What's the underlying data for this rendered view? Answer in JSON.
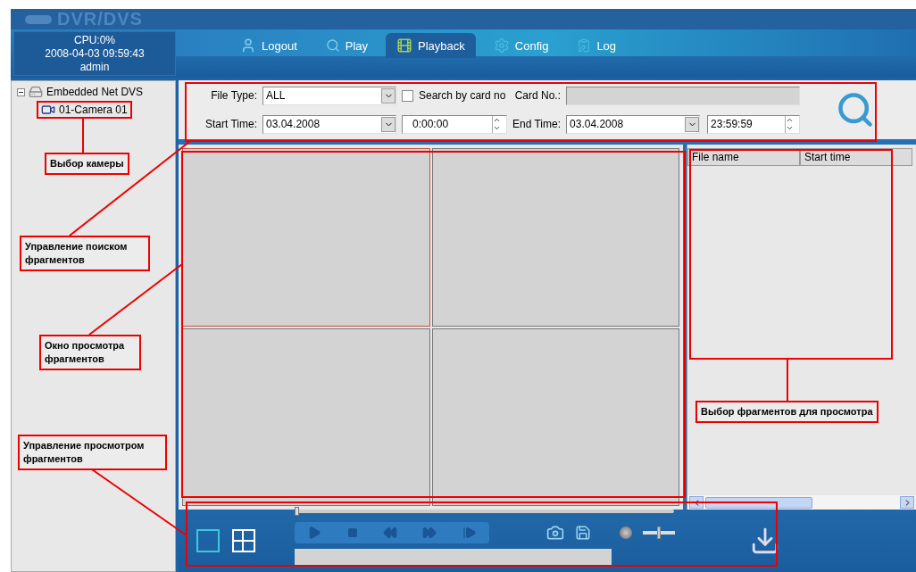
{
  "app": {
    "title": "DVR/DVS"
  },
  "status": {
    "cpu": "CPU:0%",
    "datetime": "2008-04-03 09:59:43",
    "user": "admin"
  },
  "tabs": [
    {
      "label": "Logout",
      "selected": false,
      "kind": "logout"
    },
    {
      "label": "Play",
      "selected": false,
      "kind": "play"
    },
    {
      "label": "Playback",
      "selected": true,
      "kind": "playback"
    },
    {
      "label": "Config",
      "selected": false,
      "kind": "config"
    },
    {
      "label": "Log",
      "selected": false,
      "kind": "log"
    }
  ],
  "tree": [
    {
      "label": "Embedded Net DVS",
      "expanded": true,
      "children": [
        {
          "label": "01-Camera 01"
        }
      ]
    }
  ],
  "search": {
    "file_type_label": "File Type:",
    "file_type": "ALL",
    "card_search": {
      "label": "Search by card no",
      "checked": false
    },
    "card_label": "Card No.:",
    "start_label": "Start Time:",
    "start_date": "03.04.2008",
    "start_time": "0:00:00",
    "end_label": "End Time:",
    "end_date": "03.04.2008",
    "end_time": "23:59:59"
  },
  "panes": [
    {
      "selected": true
    },
    {
      "selected": false
    },
    {
      "selected": false
    },
    {
      "selected": false
    }
  ],
  "file_list": {
    "columns": [
      "File name",
      "Start time"
    ]
  },
  "controls": {
    "position": {
      "level": 0
    },
    "layouts": [
      {
        "kind": "single",
        "selected": true
      },
      {
        "kind": "quad",
        "selected": false
      }
    ],
    "volume": {
      "level": 0.5
    }
  },
  "annotations": [
    "Выбор камеры",
    "Управление поиском фрагментов",
    "Окно просмотра фрагментов",
    "Выбор фрагментов для просмотра",
    "Управление просмотром фрагментов"
  ]
}
